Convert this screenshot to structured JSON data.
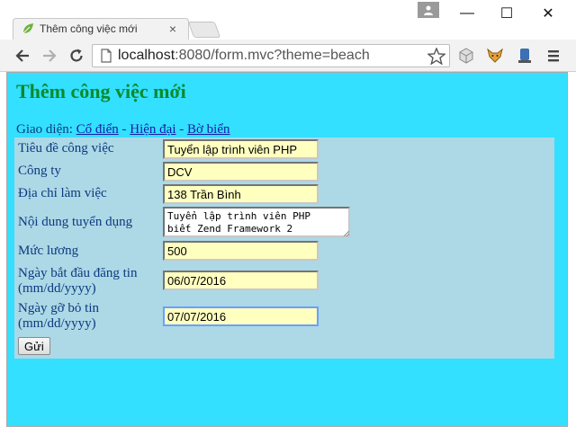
{
  "browser": {
    "tab_title": "Thêm công việc mới",
    "tab_close": "×",
    "url_host": "localhost",
    "url_rest": ":8080/form.mvc?theme=beach",
    "window_controls": {
      "minimize": "—",
      "maximize": "☐",
      "close": "✕"
    }
  },
  "page": {
    "heading": "Thêm công việc mới",
    "theme_label": "Giao diện:",
    "themes": [
      "Cổ điển",
      "Hiện đại",
      "Bờ biển"
    ],
    "theme_separator": "-"
  },
  "form": {
    "fields": [
      {
        "label": "Tiêu đề công việc",
        "value": "Tuyển lập trình viên PHP"
      },
      {
        "label": "Công ty",
        "value": "DCV"
      },
      {
        "label": "Địa chỉ làm việc",
        "value": "138 Trần Bình"
      },
      {
        "label": "Nội dung tuyển dụng",
        "value": "Tuyển lập trình viên PHP\nbiết Zend Framework 2"
      },
      {
        "label": "Mức lương",
        "value": "500"
      },
      {
        "label_line1": "Ngày bắt đầu đăng tin",
        "label_line2": "(mm/dd/yyyy)",
        "value": "06/07/2016"
      },
      {
        "label_line1": "Ngày gỡ bỏ tin",
        "label_line2": "(mm/dd/yyyy)",
        "value": "07/07/2016"
      }
    ],
    "submit_label": "Gửi"
  },
  "colors": {
    "page_background": "#33e0ff",
    "form_background": "#add8e6",
    "heading": "#0a8a2a",
    "input_background": "#ffffc0"
  }
}
